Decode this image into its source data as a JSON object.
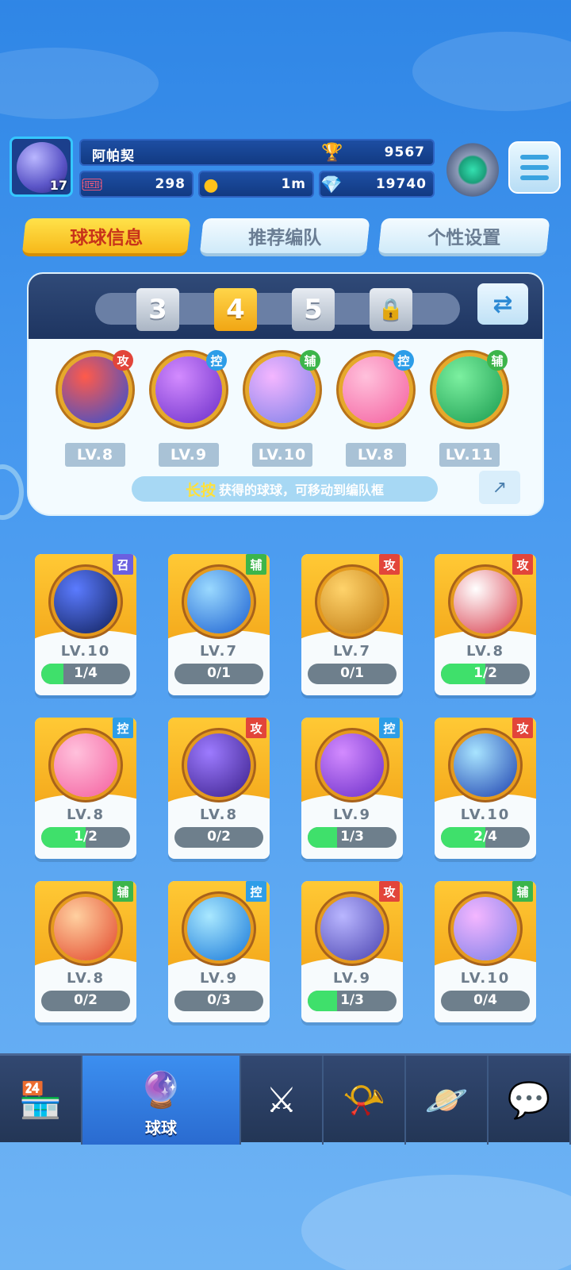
{
  "player": {
    "name": "阿帕契",
    "level": "17",
    "trophies": "9567",
    "tickets": "298",
    "coins": "1m",
    "gems": "19740"
  },
  "tabs": [
    {
      "label": "球球信息",
      "active": true
    },
    {
      "label": "推荐编队",
      "active": false
    },
    {
      "label": "个性设置",
      "active": false
    }
  ],
  "team": {
    "slots": [
      "3",
      "4",
      "5"
    ],
    "active_slot": "4",
    "balls": [
      {
        "icon": "opera-mask-icon",
        "tag": "攻",
        "level": "LV.8",
        "tag_color": "#e2453a",
        "colors": [
          "#ff5a4a",
          "#2c4fd8"
        ]
      },
      {
        "icon": "butterfly-icon",
        "tag": "控",
        "level": "LV.9",
        "tag_color": "#2d9de8",
        "colors": [
          "#d38bff",
          "#6a2dc8"
        ]
      },
      {
        "icon": "people-icon",
        "tag": "辅",
        "level": "LV.10",
        "tag_color": "#3cb54a",
        "colors": [
          "#f4b6ff",
          "#7b7fe8"
        ]
      },
      {
        "icon": "heart-icon",
        "tag": "控",
        "level": "LV.8",
        "tag_color": "#2d9de8",
        "colors": [
          "#ffc1dc",
          "#f45e9e"
        ]
      },
      {
        "icon": "star-arrow-icon",
        "tag": "辅",
        "level": "LV.11",
        "tag_color": "#3cb54a",
        "colors": [
          "#7cf0a0",
          "#189a4e"
        ]
      }
    ],
    "hint_bold": "长按",
    "hint_text": "获得的球球，可移动到编队框"
  },
  "cards": [
    {
      "icon": "black-hole-icon",
      "tag": "召",
      "tag_color": "#6b5fe0",
      "level": "LV.10",
      "progress": "1/4",
      "fill": 0.25,
      "colors": [
        "#5b7bff",
        "#10205a"
      ]
    },
    {
      "icon": "ice-crystal-icon",
      "tag": "辅",
      "tag_color": "#3cb54a",
      "level": "LV.7",
      "progress": "0/1",
      "fill": 0,
      "colors": [
        "#9ad9ff",
        "#1a5fd0"
      ]
    },
    {
      "icon": "knight-helmet-icon",
      "tag": "攻",
      "tag_color": "#e2453a",
      "level": "LV.7",
      "progress": "0/1",
      "fill": 0,
      "colors": [
        "#ffd36b",
        "#c07a12"
      ]
    },
    {
      "icon": "taiji-icon",
      "tag": "攻",
      "tag_color": "#e2453a",
      "level": "LV.8",
      "progress": "1/2",
      "fill": 0.5,
      "colors": [
        "#ffffff",
        "#d83a4a"
      ]
    },
    {
      "icon": "heart-icon",
      "tag": "控",
      "tag_color": "#2d9de8",
      "level": "LV.8",
      "progress": "1/2",
      "fill": 0.5,
      "colors": [
        "#ffc1dc",
        "#f45e9e"
      ]
    },
    {
      "icon": "sword-icon",
      "tag": "攻",
      "tag_color": "#e2453a",
      "level": "LV.8",
      "progress": "0/2",
      "fill": 0,
      "colors": [
        "#9d7bff",
        "#3a1f8a"
      ]
    },
    {
      "icon": "butterfly-icon",
      "tag": "控",
      "tag_color": "#2d9de8",
      "level": "LV.9",
      "progress": "1/3",
      "fill": 0.33,
      "colors": [
        "#d38bff",
        "#6a2dc8"
      ]
    },
    {
      "icon": "planet-ring-icon",
      "tag": "攻",
      "tag_color": "#e2453a",
      "level": "LV.10",
      "progress": "2/4",
      "fill": 0.5,
      "colors": [
        "#a8e4ff",
        "#1b3fae"
      ]
    },
    {
      "icon": "phoenix-icon",
      "tag": "辅",
      "tag_color": "#3cb54a",
      "level": "LV.8",
      "progress": "0/2",
      "fill": 0,
      "colors": [
        "#ffd0a0",
        "#e2452a"
      ]
    },
    {
      "icon": "cloud-wave-icon",
      "tag": "控",
      "tag_color": "#2d9de8",
      "level": "LV.9",
      "progress": "0/3",
      "fill": 0,
      "colors": [
        "#a9e8ff",
        "#1677d8"
      ]
    },
    {
      "icon": "pixel-face-icon",
      "tag": "攻",
      "tag_color": "#e2453a",
      "level": "LV.9",
      "progress": "1/3",
      "fill": 0.33,
      "colors": [
        "#b9b6ff",
        "#4a43b0"
      ]
    },
    {
      "icon": "people-icon",
      "tag": "辅",
      "tag_color": "#3cb54a",
      "level": "LV.10",
      "progress": "0/4",
      "fill": 0,
      "colors": [
        "#f4b6ff",
        "#7b7fe8"
      ]
    }
  ],
  "bottom_nav": [
    {
      "icon": "shop-icon",
      "label": ""
    },
    {
      "icon": "balls-icon",
      "label": "球球",
      "active": true
    },
    {
      "icon": "crossed-swords-icon",
      "label": ""
    },
    {
      "icon": "whistle-icon",
      "label": ""
    },
    {
      "icon": "planet-icon",
      "label": ""
    },
    {
      "icon": "chat-heart-icon",
      "label": ""
    }
  ]
}
